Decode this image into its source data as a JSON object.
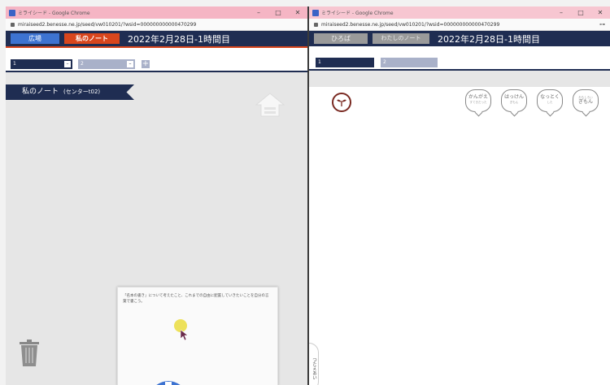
{
  "left_window": {
    "title": "ミライシード - Google Chrome",
    "url": "miraiseed2.benesse.ne.jp/seed/vw010201/?wsid=000000000000470299",
    "controls": {
      "minimize": "–",
      "maximize": "□",
      "close": "✕"
    },
    "header": {
      "hiroba_tab": "広場",
      "mynote_tab": "私のノート",
      "date_title": "2022年2月28日-1時間目"
    },
    "page_tabs": [
      {
        "label": "1",
        "mini": "–"
      },
      {
        "label": "2",
        "mini": "–"
      }
    ],
    "add_tab": "+",
    "note_label": "私のノート",
    "note_sublabel": "(センターt02)",
    "popup_text": "「名本の書き」について考えたこと、これまでの自由に配置していきたいことを自分の言葉で書こう。"
  },
  "right_window": {
    "title": "ミライシード - Google Chrome",
    "url": "miraiseed2.benesse.ne.jp/seed/vw010201/?wsid=000000000000470299",
    "controls": {
      "minimize": "–",
      "maximize": "□",
      "close": "✕"
    },
    "header": {
      "hiroba_tab": "ひろば",
      "mynote_tab": "わたしのノート",
      "date_title": "2022年2月28日-1時間目"
    },
    "page_tabs": [
      {
        "label": "1"
      },
      {
        "label": "2"
      }
    ],
    "side_handle": "つたえあい",
    "reaction_bubbles": [
      {
        "label": "かんがえ",
        "sub": "すてきだった"
      },
      {
        "label": "はっけん",
        "sub": "ぎもん"
      },
      {
        "label": "なっとく",
        "sub": "した"
      },
      {
        "label": "ぎもん",
        "sub": "おもしろい"
      }
    ]
  },
  "colors": {
    "header_navy": "#1f2d52",
    "hiroba_blue": "#3d73d1",
    "mynote_orange": "#d9461d",
    "titlebar_pink": "#f5b5c4"
  }
}
